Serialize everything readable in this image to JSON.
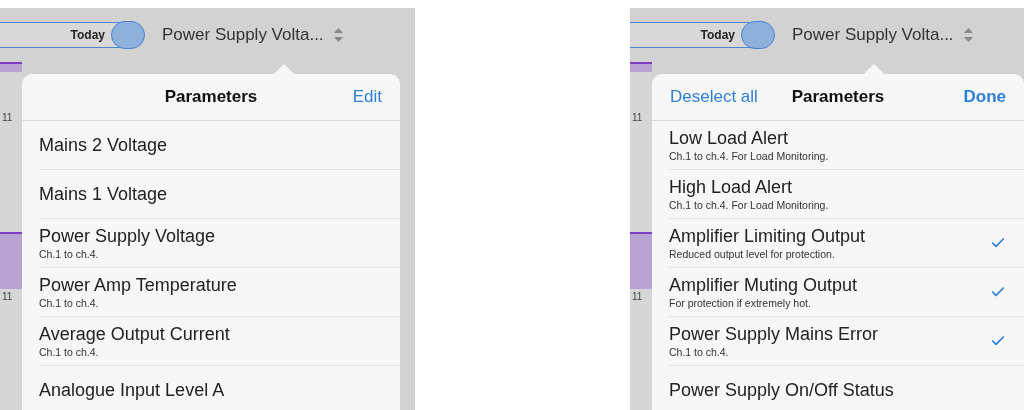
{
  "screens": [
    {
      "toolbar": {
        "segment_label": "Today",
        "title": "Power Supply Volta..."
      },
      "axis_labels": [
        "11",
        "11"
      ],
      "popover": {
        "title": "Parameters",
        "right_action": "Edit",
        "rows": [
          {
            "title": "Mains 2 Voltage"
          },
          {
            "title": "Mains 1 Voltage"
          },
          {
            "title": "Power Supply Voltage",
            "subtitle": "Ch.1 to ch.4."
          },
          {
            "title": "Power Amp Temperature",
            "subtitle": "Ch.1 to ch.4."
          },
          {
            "title": "Average Output Current",
            "subtitle": "Ch.1 to ch.4."
          },
          {
            "title": "Analogue Input Level A"
          }
        ]
      }
    },
    {
      "toolbar": {
        "segment_label": "Today",
        "title": "Power Supply Volta..."
      },
      "axis_labels": [
        "11",
        "11"
      ],
      "popover": {
        "left_action": "Deselect all",
        "title": "Parameters",
        "right_action": "Done",
        "rows": [
          {
            "title": "Low Load Alert",
            "subtitle": "Ch.1 to ch.4. For Load Monitoring.",
            "checked": false
          },
          {
            "title": "High Load Alert",
            "subtitle": "Ch.1 to ch.4. For Load Monitoring.",
            "checked": false
          },
          {
            "title": "Amplifier Limiting Output",
            "subtitle": "Reduced output level for protection.",
            "checked": true
          },
          {
            "title": "Amplifier Muting Output",
            "subtitle": "For protection if extremely hot.",
            "checked": true
          },
          {
            "title": "Power Supply Mains Error",
            "subtitle": "Ch.1 to ch.4.",
            "checked": true
          },
          {
            "title": "Power Supply On/Off Status",
            "checked": false
          }
        ]
      }
    }
  ]
}
